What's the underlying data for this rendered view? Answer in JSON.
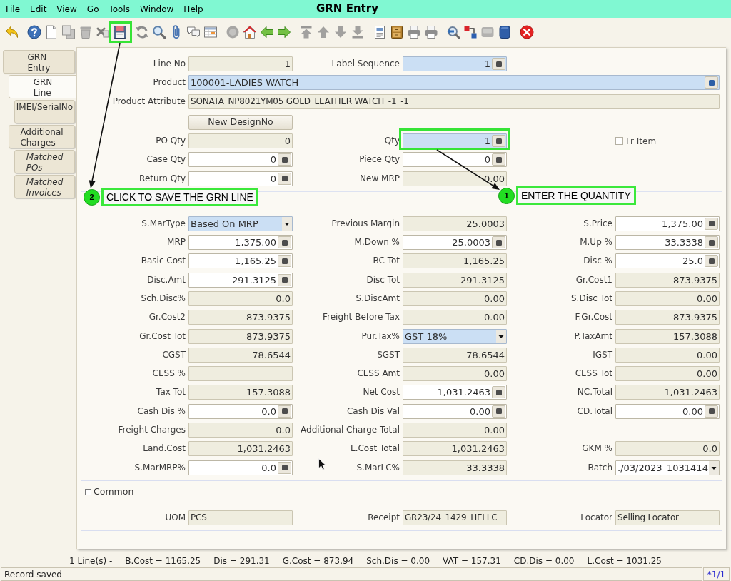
{
  "window": {
    "title": "GRN Entry"
  },
  "menu": [
    {
      "label": "File"
    },
    {
      "label": "Edit"
    },
    {
      "label": "View"
    },
    {
      "label": "Go"
    },
    {
      "label": "Tools"
    },
    {
      "label": "Window"
    },
    {
      "label": "Help"
    }
  ],
  "toolbar": [
    [
      {
        "kind": "undo",
        "disabled": false
      }
    ],
    [
      {
        "kind": "help",
        "disabled": false
      },
      {
        "kind": "new",
        "disabled": false
      },
      {
        "kind": "copy",
        "disabled": true
      },
      {
        "kind": "delete",
        "disabled": true
      },
      {
        "kind": "deleteselection",
        "disabled": true
      },
      {
        "kind": "save",
        "disabled": false
      }
    ],
    [
      {
        "kind": "refresh",
        "disabled": false
      },
      {
        "kind": "find",
        "disabled": false
      },
      {
        "kind": "attachment",
        "disabled": false
      },
      {
        "kind": "chat",
        "disabled": false
      },
      {
        "kind": "grid",
        "disabled": false
      }
    ],
    [
      {
        "kind": "history",
        "disabled": true
      },
      {
        "kind": "home",
        "disabled": false
      },
      {
        "kind": "parent",
        "disabled": false
      },
      {
        "kind": "detail",
        "disabled": false
      }
    ],
    [
      {
        "kind": "first",
        "disabled": true
      },
      {
        "kind": "previous",
        "disabled": true
      },
      {
        "kind": "next",
        "disabled": true
      },
      {
        "kind": "last",
        "disabled": true
      }
    ],
    [
      {
        "kind": "report",
        "disabled": false
      },
      {
        "kind": "archive",
        "disabled": false
      },
      {
        "kind": "preview",
        "disabled": false
      },
      {
        "kind": "print",
        "disabled": false
      }
    ],
    [
      {
        "kind": "zoom",
        "disabled": false
      },
      {
        "kind": "workflow",
        "disabled": false
      },
      {
        "kind": "request",
        "disabled": true
      },
      {
        "kind": "product",
        "disabled": false
      }
    ],
    [
      {
        "kind": "exit",
        "disabled": false
      }
    ]
  ],
  "tabs": [
    {
      "label": "GRN\nEntry",
      "selected": false,
      "read_only": false,
      "children": [
        {
          "label": "GRN\nLine",
          "selected": true,
          "read_only": false,
          "children": [
            {
              "label": "IMEI/SerialNo",
              "selected": false,
              "read_only": false
            }
          ]
        },
        {
          "label": "Additional\nCharges",
          "selected": false,
          "read_only": false,
          "children": [
            {
              "label": "Matched\nPOs",
              "selected": false,
              "read_only": true
            },
            {
              "label": "Matched\nInvoices",
              "selected": false,
              "read_only": true
            }
          ]
        }
      ]
    }
  ],
  "line_fields": {
    "rows": [
      {
        "left": {
          "label": "Line No",
          "kind": "number",
          "value": "1",
          "editable": false
        },
        "middle": {
          "label": "Label Sequence",
          "kind": "number",
          "value": "1",
          "editable": true,
          "mandatory": true
        }
      },
      {
        "full": {
          "label": "Product",
          "kind": "lookup",
          "value": "100001-LADIES WATCH",
          "editable": true,
          "mandatory": true
        }
      },
      {
        "full": {
          "label": "Product Attribute",
          "kind": "text",
          "value": "SONATA_NP8021YM05 GOLD_LEATHER WATCH_-1_-1",
          "editable": false
        }
      },
      {
        "left": {
          "kind": "button",
          "label": "New DesignNo"
        }
      },
      {
        "left": {
          "label": "PO Qty",
          "kind": "number",
          "value": "0",
          "editable": false
        },
        "middle": {
          "label": "Qty",
          "kind": "number",
          "value": "1",
          "editable": true,
          "mandatory": true
        },
        "right": {
          "kind": "checkbox",
          "label": "Fr Item",
          "checked": false
        }
      },
      {
        "left": {
          "label": "Case Qty",
          "kind": "number",
          "value": "0",
          "editable": true,
          "mandatory": false
        },
        "middle": {
          "label": "Piece Qty",
          "kind": "number",
          "value": "0",
          "editable": true,
          "mandatory": false
        }
      },
      {
        "left": {
          "label": "Return Qty",
          "kind": "number",
          "value": "0",
          "editable": true,
          "mandatory": false
        },
        "middle": {
          "label": "New MRP",
          "kind": "number",
          "value": "0.00",
          "editable": false
        }
      }
    ]
  },
  "cost_fields": {
    "rows": [
      {
        "left": {
          "label": "S.MarType",
          "kind": "select",
          "value": "Based On MRP",
          "editable": true,
          "mandatory": true
        },
        "middle": {
          "label": "Previous Margin",
          "kind": "number",
          "value": "25.0003",
          "editable": false
        },
        "right": {
          "label": "S.Price",
          "kind": "number",
          "value": "1,375.00",
          "editable": true,
          "mandatory": false
        }
      },
      {
        "left": {
          "label": "MRP",
          "kind": "number",
          "value": "1,375.00",
          "editable": true,
          "mandatory": false
        },
        "middle": {
          "label": "M.Down %",
          "kind": "number",
          "value": "25.0003",
          "editable": true,
          "mandatory": false
        },
        "right": {
          "label": "M.Up %",
          "kind": "number",
          "value": "33.3338",
          "editable": true,
          "mandatory": false
        }
      },
      {
        "left": {
          "label": "Basic Cost",
          "kind": "number",
          "value": "1,165.25",
          "editable": true,
          "mandatory": false
        },
        "middle": {
          "label": "BC Tot",
          "kind": "number",
          "value": "1,165.25",
          "editable": false
        },
        "right": {
          "label": "Disc %",
          "kind": "number",
          "value": "25.0",
          "editable": true,
          "mandatory": false
        }
      },
      {
        "left": {
          "label": "Disc.Amt",
          "kind": "number",
          "value": "291.3125",
          "editable": true,
          "mandatory": false
        },
        "middle": {
          "label": "Disc Tot",
          "kind": "number",
          "value": "291.3125",
          "editable": false
        },
        "right": {
          "label": "Gr.Cost1",
          "kind": "number",
          "value": "873.9375",
          "editable": false
        }
      },
      {
        "left": {
          "label": "Sch.Disc%",
          "kind": "number",
          "value": "0.0",
          "editable": false
        },
        "middle": {
          "label": "S.DiscAmt",
          "kind": "number",
          "value": "0.00",
          "editable": false
        },
        "right": {
          "label": "S.Disc Tot",
          "kind": "number",
          "value": "0.00",
          "editable": false
        }
      },
      {
        "left": {
          "label": "Gr.Cost2",
          "kind": "number",
          "value": "873.9375",
          "editable": false
        },
        "middle": {
          "label": "Freight Before Tax",
          "kind": "number",
          "value": "0.00",
          "editable": false
        },
        "right": {
          "label": "F.Gr.Cost",
          "kind": "number",
          "value": "873.9375",
          "editable": false
        }
      },
      {
        "left": {
          "label": "Gr.Cost Tot",
          "kind": "number",
          "value": "873.9375",
          "editable": false
        },
        "middle": {
          "label": "Pur.Tax%",
          "kind": "select",
          "value": "GST 18%",
          "editable": true,
          "mandatory": true
        },
        "right": {
          "label": "P.TaxAmt",
          "kind": "number",
          "value": "157.3088",
          "editable": false
        }
      },
      {
        "left": {
          "label": "CGST",
          "kind": "number",
          "value": "78.6544",
          "editable": false
        },
        "middle": {
          "label": "SGST",
          "kind": "number",
          "value": "78.6544",
          "editable": false
        },
        "right": {
          "label": "IGST",
          "kind": "number",
          "value": "0.00",
          "editable": false
        }
      },
      {
        "left": {
          "label": "CESS %",
          "kind": "number",
          "editable": false
        },
        "middle": {
          "label": "CESS Amt",
          "kind": "number",
          "value": "0.00",
          "editable": false
        },
        "right": {
          "label": "CESS Tot",
          "kind": "number",
          "value": "0.00",
          "editable": false
        }
      },
      {
        "left": {
          "label": "Tax Tot",
          "kind": "number",
          "value": "157.3088",
          "editable": false
        },
        "middle": {
          "label": "Net Cost",
          "kind": "number",
          "value": "1,031.2463",
          "editable": true,
          "mandatory": false
        },
        "right": {
          "label": "NC.Total",
          "kind": "number",
          "value": "1,031.2463",
          "editable": false
        }
      },
      {
        "left": {
          "label": "Cash Dis %",
          "kind": "number",
          "value": "0.0",
          "editable": true,
          "mandatory": false
        },
        "middle": {
          "label": "Cash Dis Val",
          "kind": "number",
          "value": "0.00",
          "editable": true,
          "mandatory": false
        },
        "right": {
          "label": "CD.Total",
          "kind": "number",
          "value": "0.00",
          "editable": true,
          "mandatory": false
        }
      },
      {
        "left": {
          "label": "Freight Charges",
          "kind": "number",
          "value": "0.0",
          "editable": false
        },
        "middle": {
          "label": "Additional Charge Total",
          "kind": "number",
          "value": "0.00",
          "editable": false
        }
      },
      {
        "left": {
          "label": "Land.Cost",
          "kind": "number",
          "value": "1,031.2463",
          "editable": false
        },
        "middle": {
          "label": "L.Cost Total",
          "kind": "number",
          "value": "1,031.2463",
          "editable": false
        },
        "right": {
          "label": "GKM %",
          "kind": "number",
          "value": "0.0",
          "editable": false
        }
      },
      {
        "left": {
          "label": "S.MarMRP%",
          "kind": "number",
          "value": "0.0",
          "editable": true,
          "mandatory": false
        },
        "middle": {
          "label": "S.MarLC%",
          "kind": "number",
          "value": "33.3338",
          "editable": false
        },
        "right": {
          "label": "Batch",
          "kind": "select",
          "value": "./03/2023_1031414",
          "editable": true,
          "mandatory": false
        }
      }
    ]
  },
  "common": {
    "title": "Common",
    "expanded": true,
    "rows": [
      {
        "left": {
          "label": "UOM",
          "kind": "text",
          "value": "PCS",
          "editable": false
        },
        "middle": {
          "label": "Receipt",
          "kind": "text",
          "value": "GR23/24_1429_HELLC",
          "editable": false
        },
        "right": {
          "label": "Locator",
          "kind": "text",
          "value": "Selling Locator",
          "editable": false
        }
      }
    ]
  },
  "summary": [
    "1 Line(s) -",
    "B.Cost = 1165.25",
    "Dis = 291.31",
    "G.Cost = 873.94",
    "Sch.Dis = 0.00",
    "VAT = 157.31",
    "CD.Dis = 0.00",
    "L.Cost = 1031.25"
  ],
  "status_bar": {
    "message": "Record saved",
    "record": "*1/1"
  },
  "annotations": [
    {
      "number": "2",
      "text": "CLICK TO SAVE THE GRN LINE"
    },
    {
      "number": "1",
      "text": "ENTER THE QUANTITY"
    }
  ]
}
